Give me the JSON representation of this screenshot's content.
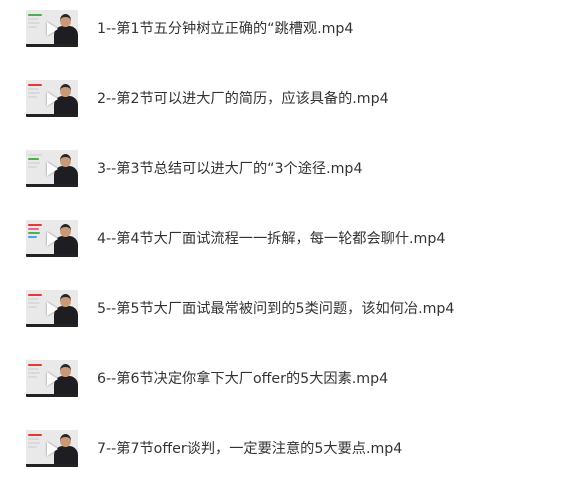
{
  "files": [
    {
      "name": "1--第1节五分钟树立正确的“跳槽观.mp4",
      "slide_colors": [
        "#4caf50",
        "#d9d9d9",
        "#d9d9d9",
        "#d9d9d9"
      ],
      "thumb_icon": "video-play-icon"
    },
    {
      "name": "2--第2节可以进大厂的简历，应该具备的.mp4",
      "slide_colors": [
        "#e53935",
        "#d9d9d9",
        "#d9d9d9",
        "#d9d9d9"
      ],
      "thumb_icon": "video-play-icon"
    },
    {
      "name": "3--第3节总结可以进大厂的“3个途径.mp4",
      "slide_colors": [
        "#d9d9d9",
        "#4caf50",
        "#d9d9d9",
        "#d9d9d9"
      ],
      "thumb_icon": "video-play-icon"
    },
    {
      "name": "4--第4节大厂面试流程一一拆解，每一轮都会聊什.mp4",
      "slide_colors": [
        "#e53935",
        "#f06292",
        "#4caf50",
        "#42a5f5"
      ],
      "thumb_icon": "video-play-icon"
    },
    {
      "name": "5--第5节大厂面试最常被问到的5类问题，该如何冶.mp4",
      "slide_colors": [
        "#e53935",
        "#d9d9d9",
        "#d9d9d9",
        "#d9d9d9"
      ],
      "thumb_icon": "video-play-icon"
    },
    {
      "name": "6--第6节决定你拿下大厂offer的5大因素.mp4",
      "slide_colors": [
        "#e53935",
        "#d9d9d9",
        "#d9d9d9",
        "#d9d9d9"
      ],
      "thumb_icon": "video-play-icon"
    },
    {
      "name": "7--第7节offer谈判，一定要注意的5大要点.mp4",
      "slide_colors": [
        "#e53935",
        "#d9d9d9",
        "#d9d9d9",
        "#d9d9d9"
      ],
      "thumb_icon": "video-play-icon"
    }
  ]
}
